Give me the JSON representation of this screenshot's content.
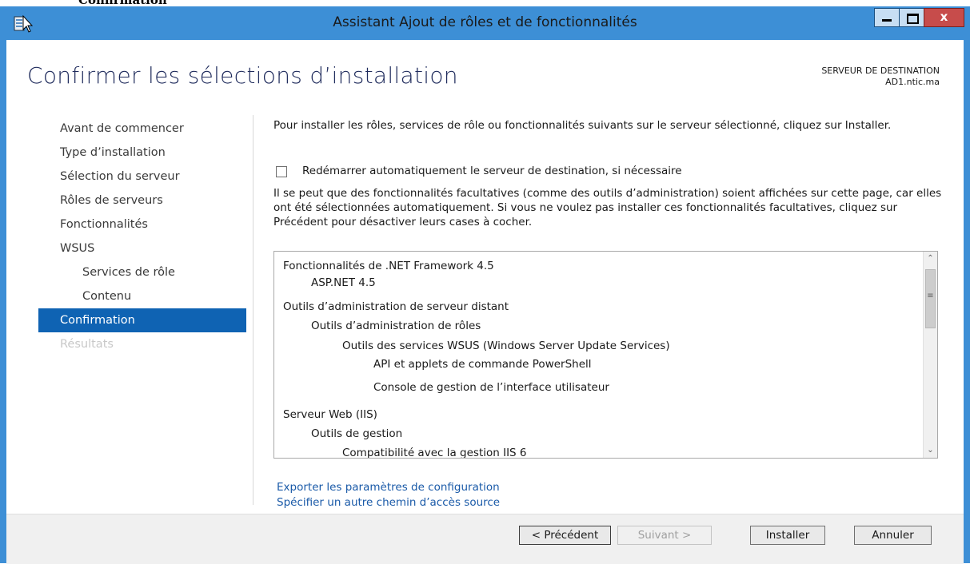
{
  "top_strip": {
    "text": "Confirmation"
  },
  "window": {
    "title": "Assistant Ajout de rôles et de fonctionnalités",
    "controls": {
      "minimize": "minimize-icon",
      "maximize": "maximize-icon",
      "close": "x"
    }
  },
  "page": {
    "heading": "Confirmer les sélections d’installation",
    "destination_label": "SERVEUR DE DESTINATION",
    "destination_server": "AD1.ntic.ma"
  },
  "nav": {
    "items": [
      {
        "label": "Avant de commencer",
        "state": "normal"
      },
      {
        "label": "Type d’installation",
        "state": "normal"
      },
      {
        "label": "Sélection du serveur",
        "state": "normal"
      },
      {
        "label": "Rôles de serveurs",
        "state": "normal"
      },
      {
        "label": "Fonctionnalités",
        "state": "normal"
      },
      {
        "label": "WSUS",
        "state": "normal"
      },
      {
        "label": "Services de rôle",
        "state": "sub"
      },
      {
        "label": "Contenu",
        "state": "sub"
      },
      {
        "label": "Confirmation",
        "state": "active"
      },
      {
        "label": "Résultats",
        "state": "disabled"
      }
    ]
  },
  "main": {
    "intro": "Pour installer les rôles, services de rôle ou fonctionnalités suivants sur le serveur sélectionné, cliquez sur Installer.",
    "restart_checkbox_label": "Redémarrer automatiquement le serveur de destination, si nécessaire",
    "restart_checked": false,
    "note": "Il se peut que des fonctionnalités facultatives (comme des outils d’administration) soient affichées sur cette page, car elles ont été sélectionnées automatiquement. Si vous ne voulez pas installer ces fonctionnalités facultatives, cliquez sur Précédent pour désactiver leurs cases à cocher.",
    "selections": [
      "Fonctionnalités de .NET Framework 4.5",
      "ASP.NET 4.5",
      "Outils d’administration de serveur distant",
      "Outils d’administration de rôles",
      "Outils des services WSUS (Windows Server Update Services)",
      "API et applets de commande PowerShell",
      "Console de gestion de l’interface utilisateur",
      "Serveur Web (IIS)",
      "Outils de gestion",
      "Compatibilité avec la gestion IIS 6"
    ],
    "links": {
      "export": "Exporter les paramètres de configuration",
      "source_path": "Spécifier un autre chemin d’accès source"
    }
  },
  "footer": {
    "previous": "< Précédent",
    "next": "Suivant >",
    "install": "Installer",
    "cancel": "Annuler"
  },
  "colors": {
    "title_bar": "#3d8fd6",
    "nav_active": "#0f63b3",
    "link": "#1a5aa8",
    "close_button": "#c74c4b"
  }
}
